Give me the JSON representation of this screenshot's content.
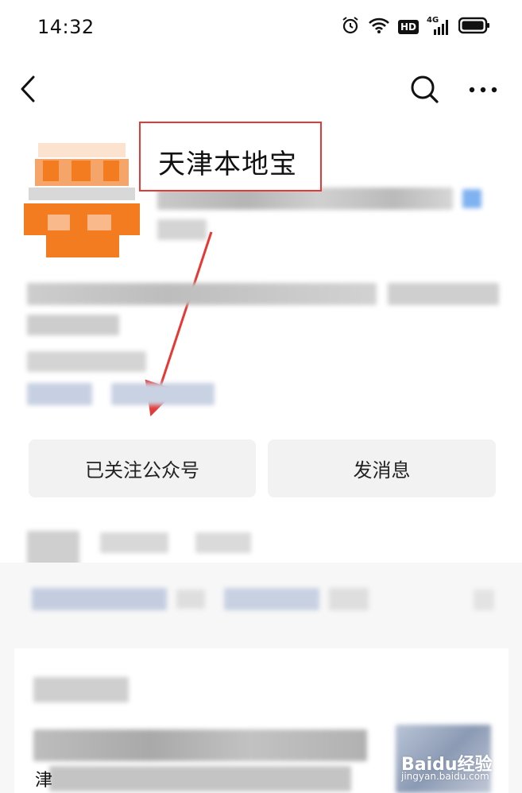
{
  "status_bar": {
    "time": "14:32",
    "icons": [
      "alarm-icon",
      "wifi-icon",
      "hd-icon",
      "signal-4g-icon",
      "battery-icon"
    ],
    "hd_label": "HD",
    "network_label": "4G"
  },
  "nav": {
    "back_icon": "back-chevron-icon",
    "search_icon": "search-icon",
    "more_icon": "more-dots-icon"
  },
  "profile": {
    "name": "天津本地宝"
  },
  "actions": {
    "follow_label": "已关注公众号",
    "message_label": "发消息"
  },
  "article_card": {
    "partial_text": "津"
  },
  "watermark": {
    "text": "Baidu经验",
    "sub": "jingyan.baidu.com"
  },
  "colors": {
    "accent_red": "#e53935",
    "avatar_orange": "#f47c20",
    "button_bg": "#f2f2f2"
  }
}
